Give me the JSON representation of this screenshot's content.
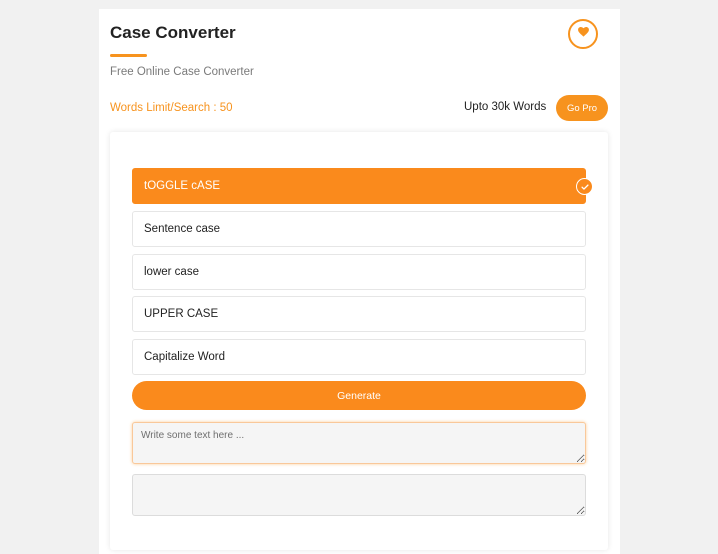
{
  "app": {
    "title": "Case Converter",
    "subtitle": "Free Online Case Converter",
    "favorite_icon": "heart-icon"
  },
  "limits": {
    "label": "Words Limit/Search : 50",
    "upgrade_text": "Upto 30k Words",
    "gopro_label": "Go Pro"
  },
  "options": [
    {
      "label": "tOGGLE cASE",
      "selected": true
    },
    {
      "label": "Sentence case",
      "selected": false
    },
    {
      "label": "lower case",
      "selected": false
    },
    {
      "label": "UPPER CASE",
      "selected": false
    },
    {
      "label": "Capitalize Word",
      "selected": false
    }
  ],
  "generate_label": "Generate",
  "input": {
    "placeholder": "Write some text here ...",
    "value": ""
  },
  "output": {
    "value": ""
  },
  "colors": {
    "accent": "#fa8a1c",
    "background": "#f1f1f1"
  }
}
